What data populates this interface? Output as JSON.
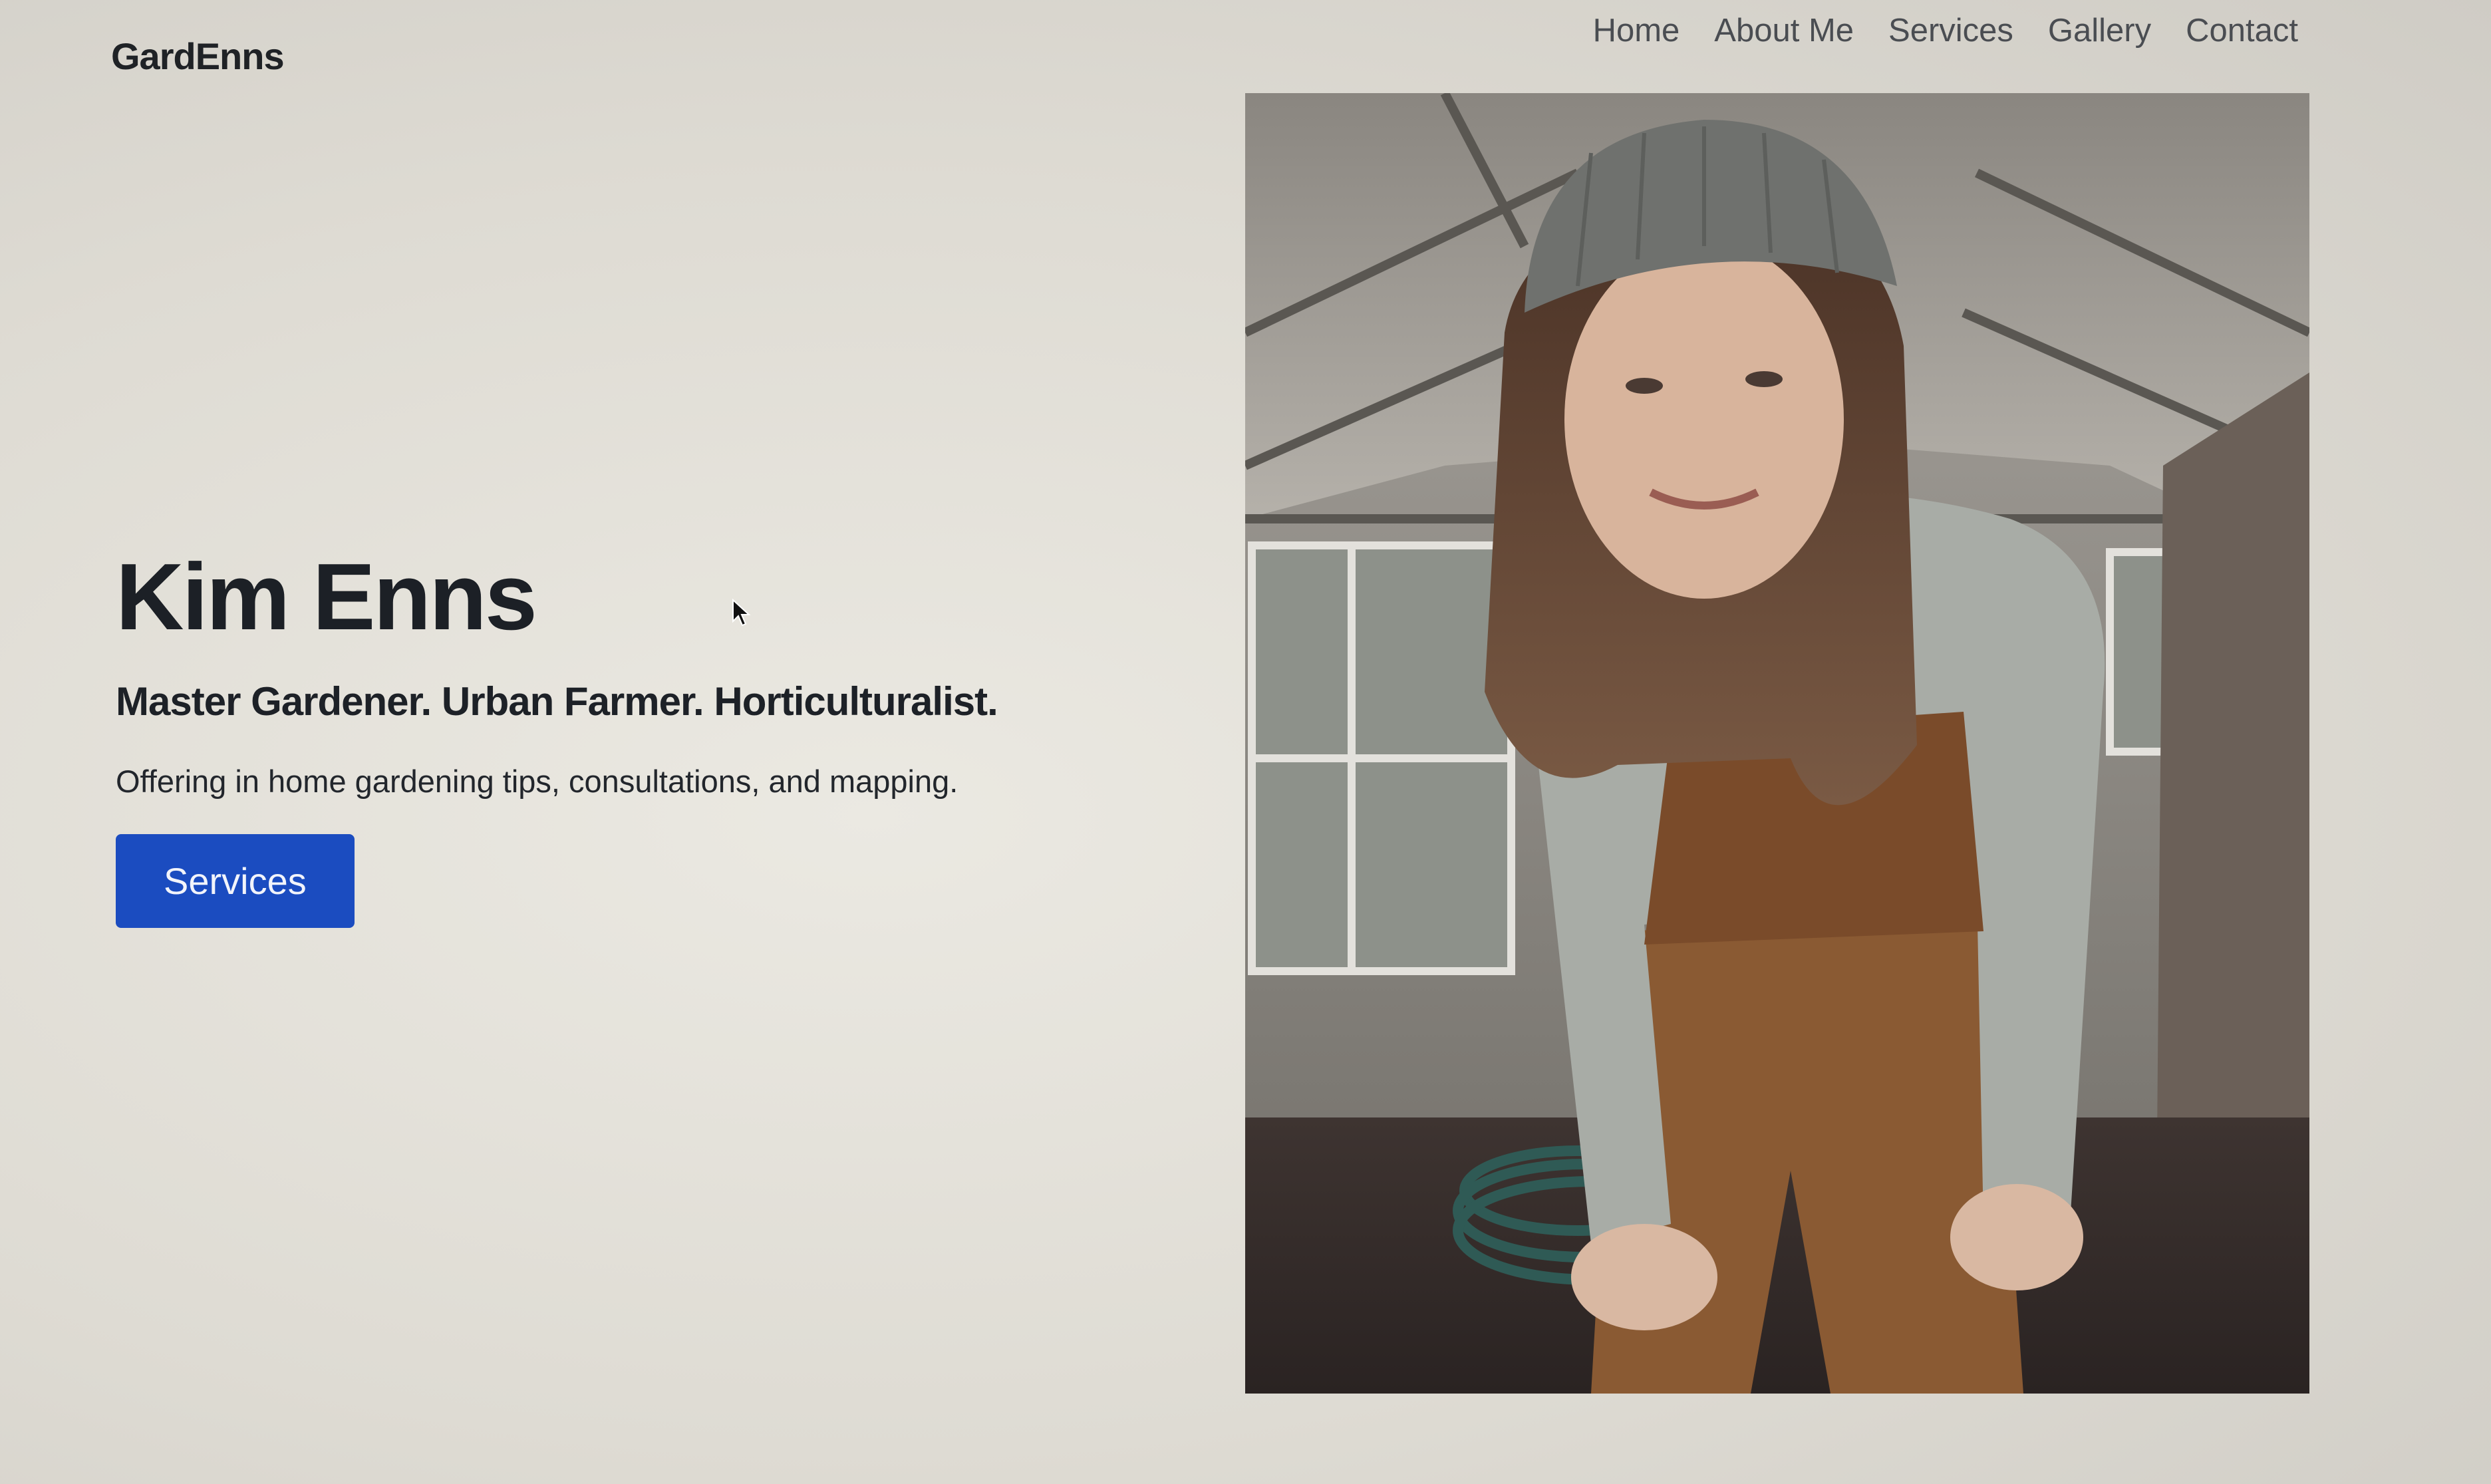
{
  "header": {
    "brand": "GardEnns",
    "nav": [
      {
        "label": "Home"
      },
      {
        "label": "About Me"
      },
      {
        "label": "Services"
      },
      {
        "label": "Gallery"
      },
      {
        "label": "Contact"
      }
    ]
  },
  "hero": {
    "name": "Kim Enns",
    "tagline": "Master Gardener. Urban Farmer. Horticulturalist.",
    "description": "Offering in home gardening tips, consultations, and mapping.",
    "button_label": "Services"
  },
  "colors": {
    "accent": "#1b4cc0",
    "text": "#1e2126",
    "nav_text": "#4a4d52"
  },
  "icons": {
    "cursor": "mouse-pointer-icon"
  }
}
